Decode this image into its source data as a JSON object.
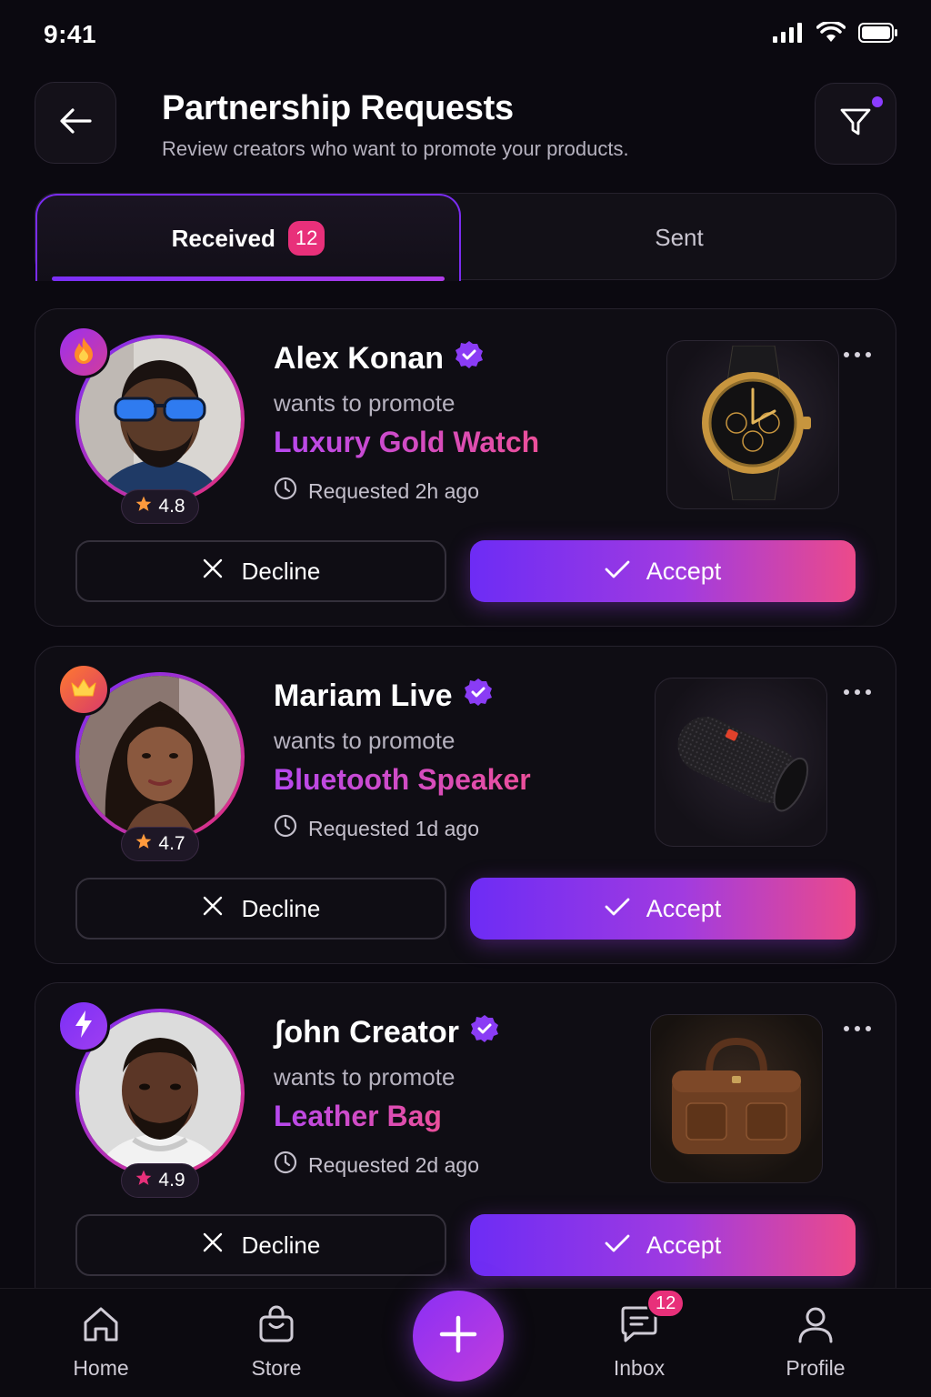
{
  "status": {
    "time": "9:41"
  },
  "header": {
    "title": "Partnership Requests",
    "subtitle": "Review creators who want to promote your products."
  },
  "tabs": {
    "received_label": "Received",
    "received_count": "12",
    "sent_label": "Sent"
  },
  "requests": [
    {
      "name": "Alex Konan",
      "wants": "wants to promote",
      "product": "Luxury Gold Watch",
      "requested": "Requested 2h ago",
      "rating": "4.8",
      "badge_icon": "fire-icon",
      "product_icon": "watch-icon"
    },
    {
      "name": "Mariam Live",
      "wants": "wants to promote",
      "product": "Bluetooth Speaker",
      "requested": "Requested 1d ago",
      "rating": "4.7",
      "badge_icon": "crown-icon",
      "product_icon": "speaker-icon"
    },
    {
      "name": "ʃohn Creator",
      "wants": "wants to promote",
      "product": "Leather Bag",
      "requested": "Requested 2d ago",
      "rating": "4.9",
      "badge_icon": "lightning-icon",
      "product_icon": "bag-icon"
    }
  ],
  "actions": {
    "decline": "Decline",
    "accept": "Accept"
  },
  "nav": {
    "home": "Home",
    "store": "Store",
    "inbox": "Inbox",
    "inbox_badge": "12",
    "profile": "Profile"
  },
  "colors": {
    "background": "#0b0910",
    "accent_purple": "#7b2ff7",
    "accent_pink": "#ec4a8a",
    "badge_pink": "#e8307a"
  }
}
